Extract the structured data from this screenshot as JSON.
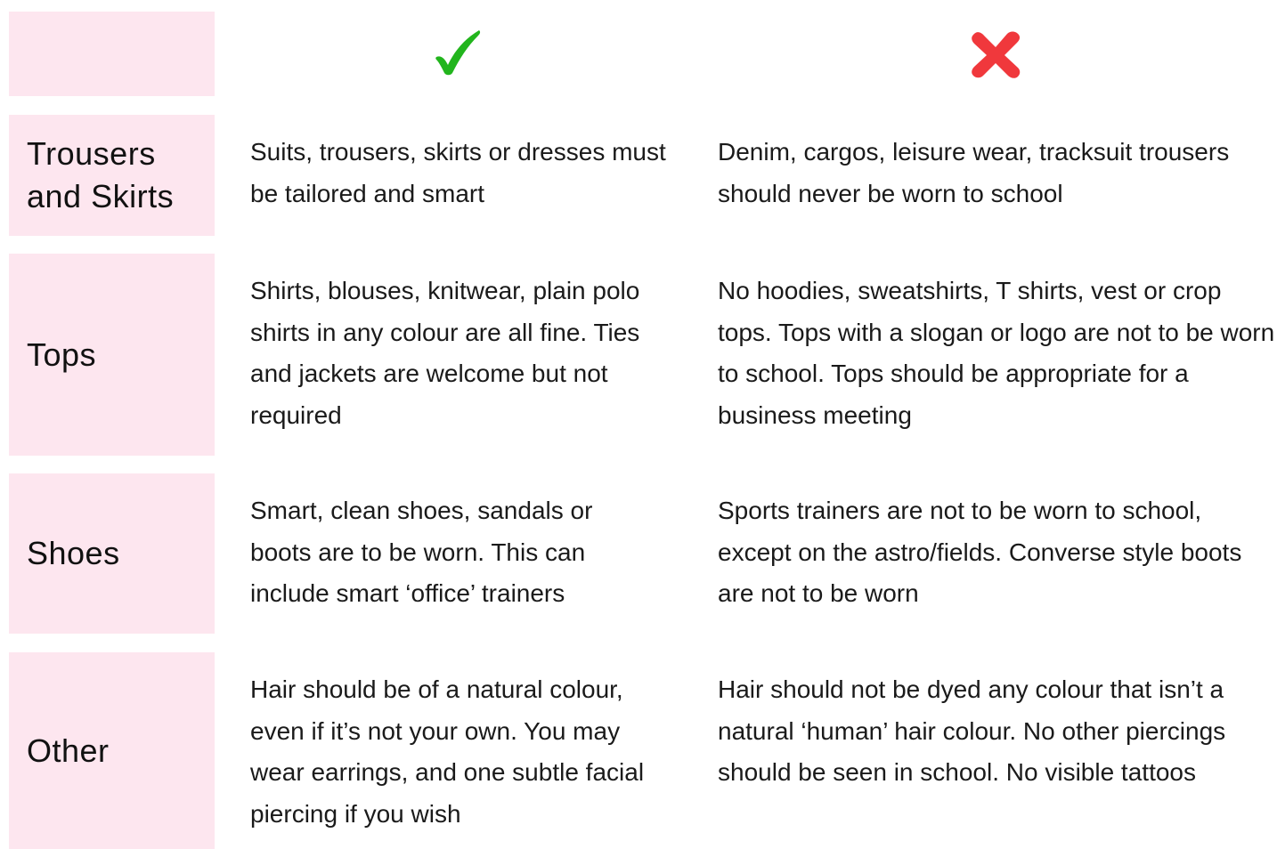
{
  "header": {
    "do_icon": "check-mark-icon",
    "dont_icon": "cross-mark-icon",
    "do_color": "#22b51d",
    "dont_color": "#f0383c",
    "label_bg": "#fde6ef"
  },
  "rows": [
    {
      "label": "Trousers and Skirts",
      "do": "Suits, trousers, skirts or dresses must be tailored and smart",
      "dont": "Denim, cargos, leisure wear, tracksuit trousers should never be worn to school"
    },
    {
      "label": "Tops",
      "do": "Shirts, blouses, knitwear, plain polo shirts in any colour are all fine. Ties and jackets are welcome but not required",
      "dont": "No hoodies, sweatshirts, T shirts, vest or crop tops. Tops with a slogan or logo are not to be worn to school. Tops should be appropriate for a business meeting"
    },
    {
      "label": "Shoes",
      "do": "Smart, clean shoes, sandals or boots are to be worn. This can include smart ‘office’ trainers",
      "dont": "Sports trainers are not to be worn to school, except on the astro/fields. Converse style boots are not to be worn"
    },
    {
      "label": "Other",
      "do": "Hair should be of a natural colour, even if it’s not your own. You may wear earrings, and one subtle facial piercing if you wish",
      "dont": "Hair should not be dyed any colour that isn’t a natural ‘human’ hair colour. No other piercings should be seen in school. No visible tattoos"
    }
  ]
}
